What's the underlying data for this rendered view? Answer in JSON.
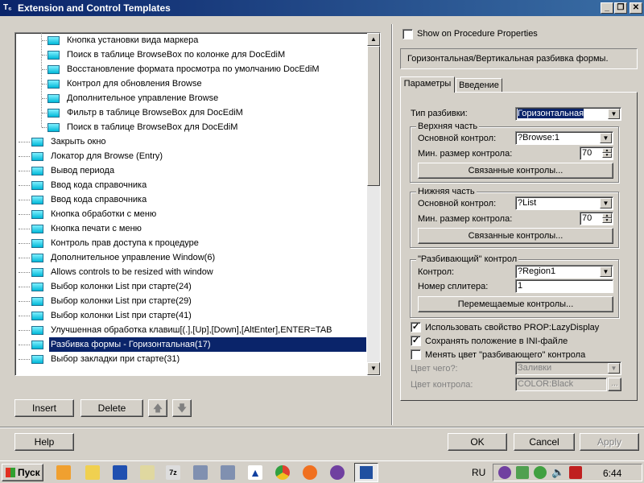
{
  "window": {
    "title": "Extension and Control Templates",
    "icon_text": "T₆"
  },
  "tree": {
    "child_items": [
      "Кнопка установки вида маркера",
      "Поиск в таблице BrowseBox по колонке для DocEdiM",
      "Восстановление формата просмотра по умолчанию DocEdiM",
      "Контрол для обновления Browse",
      "Дополнительное управление Browse",
      "Фильтр в таблице BrowseBox для DocEdiM",
      "Поиск в таблице BrowseBox для DocEdiM"
    ],
    "items": [
      "Закрыть окно",
      "Локатор для Browse (Entry)",
      "Вывод периода",
      "Ввод кода справочника",
      "Ввод кода справочника",
      "Кнопка обработки с меню",
      "Кнопка печати с меню",
      "Контроль прав доступа к процедуре",
      "Дополнительное управление Window(6)",
      "Allows controls to be resized with window",
      "Выбор колонки List при старте(24)",
      "Выбор колонки List при старте(29)",
      "Выбор колонки List при старте(41)",
      "Улучшенная обработка клавиш[(.],[Up],[Down],[AltEnter],ENTER=TAB",
      "Разбивка формы - Горизонтальная(17)",
      "Выбор закладки при старте(31)"
    ],
    "selected_index": 14
  },
  "left_buttons": {
    "insert": "Insert",
    "delete": "Delete"
  },
  "right_panel": {
    "show_on_procedure": "Show on Procedure Properties",
    "description": "Горизонтальная/Вертикальная разбивка формы.",
    "tabs": [
      "Параметры",
      "Введение"
    ],
    "split_type_label": "Тип разбивки:",
    "split_type_value": "Горизонтальная",
    "upper": {
      "title": "Верхняя часть",
      "control_label": "Основной контрол:",
      "control_value": "?Browse:1",
      "min_label": "Мин. размер контрола:",
      "min_value": "70",
      "linked_button": "Связанные контролы..."
    },
    "lower": {
      "title": "Нижняя часть",
      "control_label": "Основной контрол:",
      "control_value": "?List",
      "min_label": "Мин. размер контрола:",
      "min_value": "70",
      "linked_button": "Связанные контролы..."
    },
    "splitter": {
      "title": "\"Разбивающий\" контрол",
      "control_label": "Контрол:",
      "control_value": "?Region1",
      "number_label": "Номер сплитера:",
      "number_value": "1",
      "moved_button": "Перемещаемые контролы..."
    },
    "checkboxes": [
      {
        "label": "Использовать свойство PROP:LazyDisplay",
        "checked": true
      },
      {
        "label": "Сохранять положение в INI-файле",
        "checked": true
      },
      {
        "label": "Менять цвет \"разбивающего\" контрола",
        "checked": false
      }
    ],
    "color_what_label": "Цвет чего?:",
    "color_what_value": "Заливки",
    "color_label": "Цвет контрола:",
    "color_value": "COLOR:Black",
    "color_btn": "..."
  },
  "bottom": {
    "help": "Help",
    "ok": "OK",
    "cancel": "Cancel",
    "apply": "Apply"
  },
  "taskbar": {
    "start": "Пуск",
    "lang": "RU",
    "clock": "6:44"
  }
}
